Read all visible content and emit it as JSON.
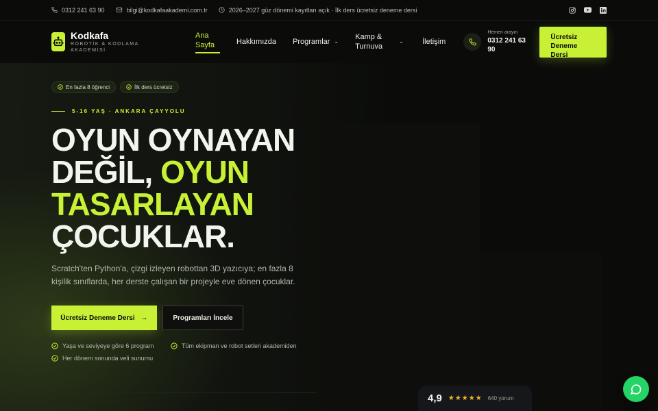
{
  "topbar": {
    "phone": "0312 241 63 90",
    "email": "bilgi@kodkafaakademi.com.tr",
    "notice": "2026–2027 güz dönemi kayıtları açık · İlk ders ücretsiz deneme dersi",
    "social_icons": [
      "instagram-icon",
      "youtube-icon",
      "linkedin-icon"
    ]
  },
  "brand": {
    "name": "Kodkafa",
    "subtitle": "ROBOTİK & KODLAMA AKADEMİSİ",
    "accent": "#c8f135"
  },
  "nav": {
    "items": [
      {
        "label": "Ana Sayfa",
        "active": true
      },
      {
        "label": "Hakkımızda"
      },
      {
        "label": "Programlar",
        "dropdown": true
      },
      {
        "label": "Kamp & Turnuva",
        "dropdown": true
      },
      {
        "label": "İletişim"
      }
    ]
  },
  "header": {
    "call_label": "Hemen arayın",
    "call_number": "0312 241 63 90",
    "cta": "Ücretsiz Deneme Dersi"
  },
  "hero": {
    "badges": [
      "En fazla 8 öğrenci",
      "İlk ders ücretsiz"
    ],
    "eyebrow": "5-16 YAŞ · ANKARA ÇAYYOLU",
    "headline_1": "OYUN OYNAYAN",
    "headline_2a": "DEĞİL, ",
    "headline_2b": "OYUN",
    "headline_3": "TASARLAYAN",
    "headline_4": "ÇOCUKLAR.",
    "description": "Scratch'ten Python'a, çizgi izleyen robottan 3D yazıcıya; en fazla 8 kişilik sınıflarda, her derste çalışan bir projeyle eve dönen çocuklar.",
    "primary_button": "Ücretsiz Deneme Dersi",
    "secondary_button": "Programları İncele",
    "features": [
      "Yaşa ve seviyeye göre 6 program",
      "Tüm ekipman ve robot setleri akademiden",
      "Her dönem sonunda veli sunumu"
    ]
  },
  "rating": {
    "score": "4,9",
    "stars": 5,
    "count": "640 yorum"
  },
  "colors": {
    "background": "#0b0c0a",
    "accent": "#c8f135",
    "star": "#f5b82e",
    "whatsapp": "#25d366"
  }
}
